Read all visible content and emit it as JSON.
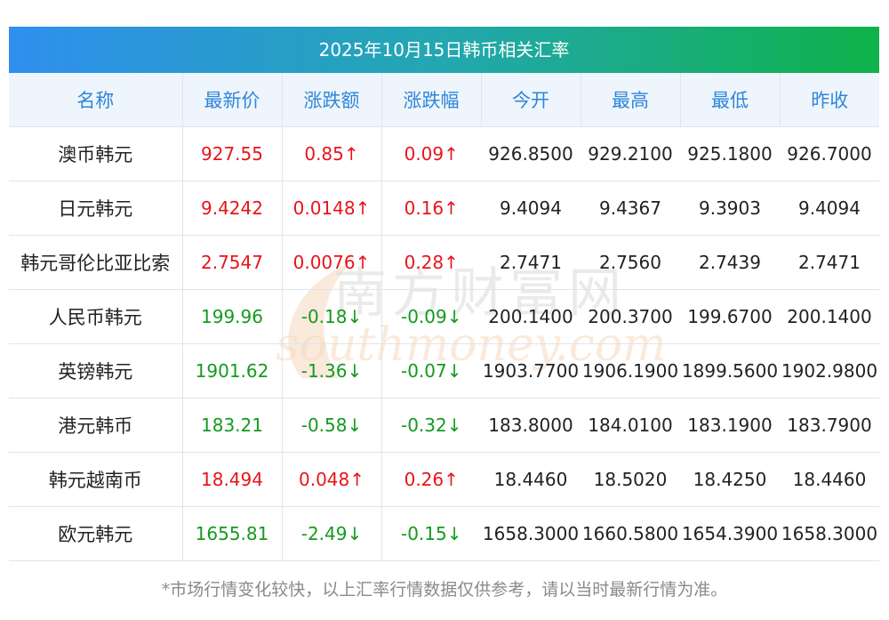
{
  "title": "2025年10月15日韩币相关汇率",
  "columns": [
    "名称",
    "最新价",
    "涨跌额",
    "涨跌幅",
    "今开",
    "最高",
    "最低",
    "昨收"
  ],
  "rows": [
    {
      "name": "澳币韩元",
      "price": "927.55",
      "change": "0.85↑",
      "pct": "0.09↑",
      "open": "926.8500",
      "high": "929.2100",
      "low": "925.1800",
      "prev": "926.7000",
      "dir": "up"
    },
    {
      "name": "日元韩元",
      "price": "9.4242",
      "change": "0.0148↑",
      "pct": "0.16↑",
      "open": "9.4094",
      "high": "9.4367",
      "low": "9.3903",
      "prev": "9.4094",
      "dir": "up"
    },
    {
      "name": "韩元哥伦比亚比索",
      "price": "2.7547",
      "change": "0.0076↑",
      "pct": "0.28↑",
      "open": "2.7471",
      "high": "2.7560",
      "low": "2.7439",
      "prev": "2.7471",
      "dir": "up"
    },
    {
      "name": "人民币韩元",
      "price": "199.96",
      "change": "-0.18↓",
      "pct": "-0.09↓",
      "open": "200.1400",
      "high": "200.3700",
      "low": "199.6700",
      "prev": "200.1400",
      "dir": "down"
    },
    {
      "name": "英镑韩元",
      "price": "1901.62",
      "change": "-1.36↓",
      "pct": "-0.07↓",
      "open": "1903.7700",
      "high": "1906.1900",
      "low": "1899.5600",
      "prev": "1902.9800",
      "dir": "down"
    },
    {
      "name": "港元韩币",
      "price": "183.21",
      "change": "-0.58↓",
      "pct": "-0.32↓",
      "open": "183.8000",
      "high": "184.0100",
      "low": "183.1900",
      "prev": "183.7900",
      "dir": "down"
    },
    {
      "name": "韩元越南币",
      "price": "18.494",
      "change": "0.048↑",
      "pct": "0.26↑",
      "open": "18.4460",
      "high": "18.5020",
      "low": "18.4250",
      "prev": "18.4460",
      "dir": "up"
    },
    {
      "name": "欧元韩元",
      "price": "1655.81",
      "change": "-2.49↓",
      "pct": "-0.15↓",
      "open": "1658.3000",
      "high": "1660.5800",
      "low": "1654.3900",
      "prev": "1658.3000",
      "dir": "down"
    }
  ],
  "watermark": {
    "cn": "南方财富网",
    "en": "southmoney.com"
  },
  "footnote": "*市场行情变化较快，以上汇率行情数据仅供参考，请以当时最新行情为准。",
  "colors": {
    "up": "#e8141b",
    "down": "#139a1f",
    "header_text": "#2f86d8",
    "header_bg": "#eef5fc"
  }
}
